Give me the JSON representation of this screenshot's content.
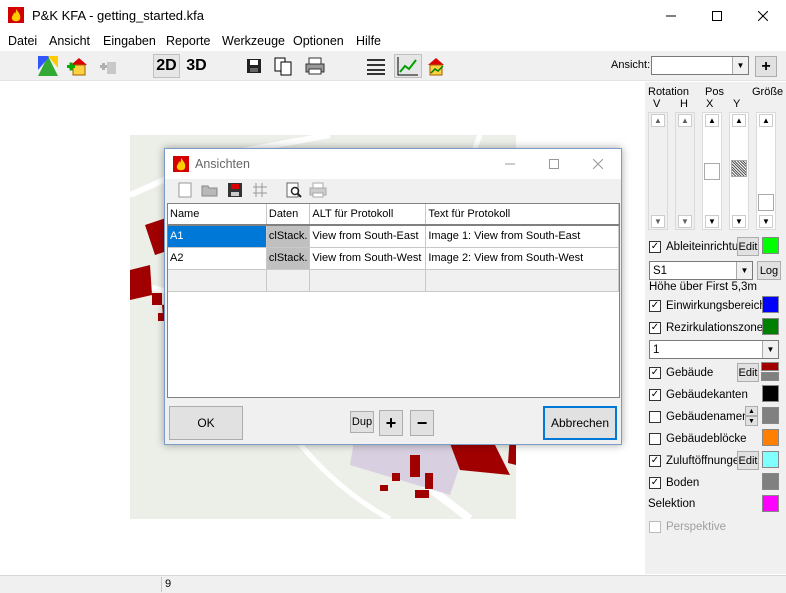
{
  "window": {
    "title": "P&K KFA - getting_started.kfa"
  },
  "menu": [
    "Datei",
    "Ansicht",
    "Eingaben",
    "Reporte",
    "Werkzeuge",
    "Optionen",
    "Hilfe"
  ],
  "toolbar": {
    "btn_2d": "2D",
    "btn_3d": "3D",
    "ansicht_label": "Ansicht:",
    "ansicht_value": "",
    "add_label": "+"
  },
  "panel": {
    "rotation": "Rotation",
    "pos": "Pos",
    "groesse": "Größe",
    "v": "V",
    "h": "H",
    "x": "X",
    "y": "Y",
    "ableit": "Ableiteinrichtu",
    "edit": "Edit",
    "source_value": "S1",
    "log": "Log",
    "hoehe": "Höhe über First 5,3m",
    "einwirkung": "Einwirkungsbereich",
    "rezirk": "Rezirkulationszone",
    "rezirk_value": "1",
    "gebaeude": "Gebäude",
    "kanten": "Gebäudekanten",
    "namen": "Gebäudenamen",
    "bloecke": "Gebäudeblöcke",
    "zuluft": "Zuluftöffnunge",
    "boden": "Boden",
    "selektion": "Selektion",
    "perspektive": "Perspektive",
    "colors": {
      "ableit": "#00ff00",
      "einwirkung": "#0000ff",
      "rezirk": "#008000",
      "gebaeude_top": "#a00000",
      "gebaeude_bottom": "#808080",
      "kanten": "#000000",
      "namen": "#808080",
      "bloecke": "#ff8000",
      "zuluft": "#80ffff",
      "boden": "#808080",
      "selektion": "#ff00ff"
    }
  },
  "status": {
    "cell1": "",
    "cell2": "9"
  },
  "dialog": {
    "title": "Ansichten",
    "columns": [
      "Name",
      "Daten",
      "ALT für Protokoll",
      "Text für Protokoll"
    ],
    "rows": [
      [
        "A1",
        "clStack.",
        "View from South-East",
        "Image 1: View from South-East"
      ],
      [
        "A2",
        "clStack.",
        "View from South-West",
        "Image 2: View from South-West"
      ]
    ],
    "ok": "OK",
    "dup": "Dup",
    "plus": "+",
    "minus": "−",
    "cancel": "Abbrechen"
  }
}
